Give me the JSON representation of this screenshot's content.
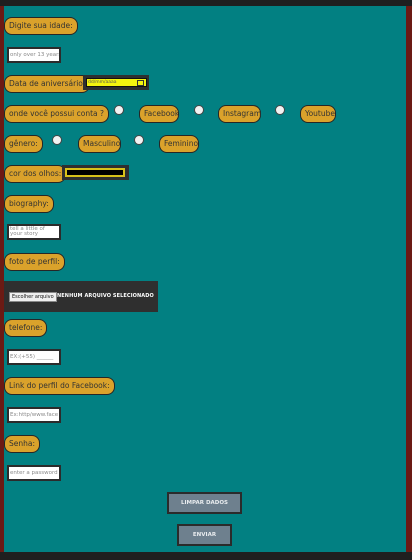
{
  "form": {
    "idade_label": "Digite sua idade:",
    "idade_placeholder": "only over 13 years",
    "aniversario_label": "Data de aniversário:",
    "aniversario_placeholder": "dd/mm/aaaa",
    "conta_label": "onde você possui conta ?",
    "conta_options": [
      "Facebook",
      "Instagram",
      "Youtube"
    ],
    "genero_label": "gênero:",
    "genero_options": [
      "Masculino",
      "Feminino"
    ],
    "olhos_label": "cor dos olhos:",
    "olhos_value": "#000000",
    "biography_label": "biography:",
    "biography_placeholder": "tell a little of your story",
    "foto_label": "foto de perfil:",
    "file_button": "Escolher arquivo",
    "file_status": "NENHUM ARQUIVO SELECIONADO",
    "telefone_label": "telefone:",
    "telefone_placeholder": "EX:(+55) ______",
    "facebook_label": "Link do perfil do Facebook:",
    "facebook_placeholder": "Ex:http/www.face",
    "senha_label": "Senha:",
    "senha_placeholder": "enter a password",
    "limpar_button": "LIMPAR DADOS",
    "enviar_button": "ENVIAR"
  },
  "colors": {
    "background": "#028082",
    "label": "#daa22b",
    "date_input": "#f4f40f",
    "button": "#6e808e"
  }
}
